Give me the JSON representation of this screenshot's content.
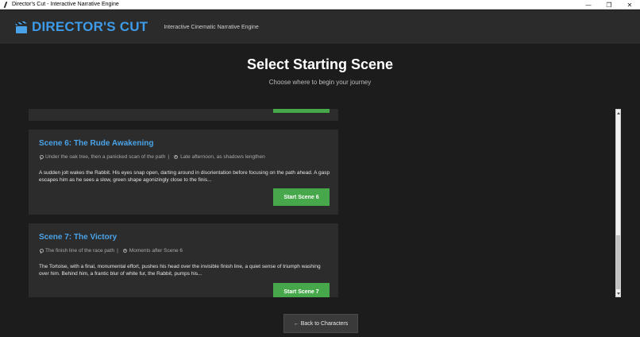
{
  "window": {
    "title": "Director's Cut - Interactive Narrative Engine",
    "controls": {
      "minimize": "—",
      "restore": "❐",
      "close": "✕"
    }
  },
  "header": {
    "icon": "clapperboard-icon",
    "brand": "DIRECTOR'S CUT",
    "tagline": "Interactive Cinematic Narrative Engine"
  },
  "page": {
    "title": "Select Starting Scene",
    "subtitle": "Choose where to begin your journey"
  },
  "scenes": [
    {
      "title": "Scene 6: The Rude Awakening",
      "location": "Under the oak tree, then a panicked scan of the path",
      "time": "Late afternoon, as shadows lengthen",
      "description": "A sudden jolt wakes the Rabbit. His eyes snap open, darting around in disorientation before focusing on the path ahead. A gasp escapes him as he sees a slow, green shape agonizingly close to the finis...",
      "button": "Start Scene 6"
    },
    {
      "title": "Scene 7: The Victory",
      "location": "The finish line of the race path",
      "time": "Moments after Scene 6",
      "description": "The Tortoise, with a final, monumental effort, pushes his head over the invisible finish line, a quiet sense of triumph washing over him. Behind him, a frantic blur of white fur, the Rabbit, pumps his...",
      "button": "Start Scene 7"
    }
  ],
  "back_button": "← Back to Characters",
  "colors": {
    "background": "#1c1c1c",
    "header": "#2b2b2b",
    "card": "#2c2c2c",
    "accent": "#4aa3e8",
    "start_button": "#46a84a"
  }
}
